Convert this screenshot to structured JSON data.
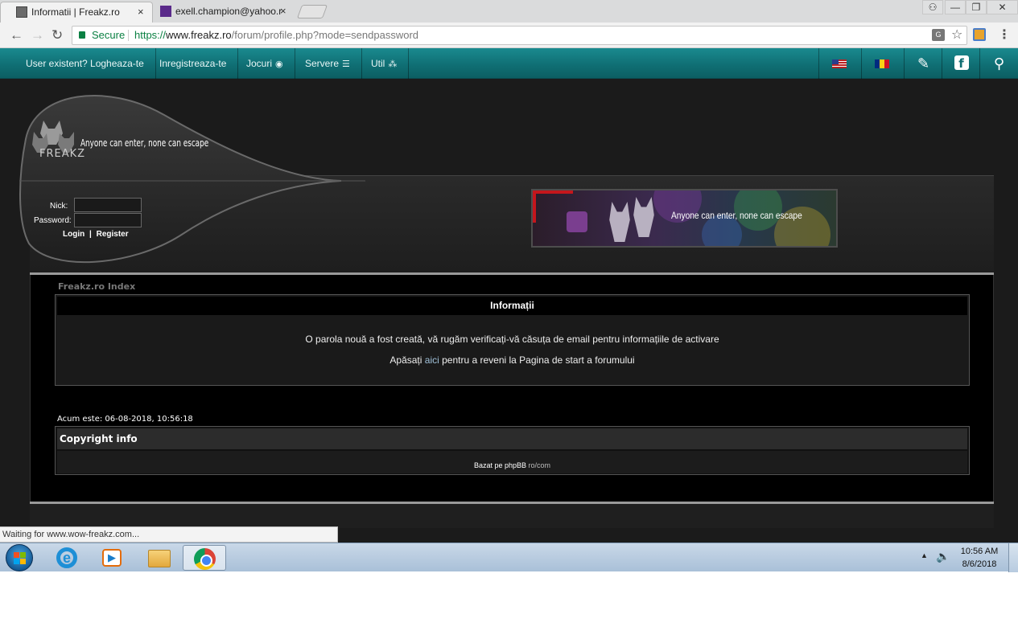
{
  "browser": {
    "tabs": [
      {
        "title": "Informatii | Freakz.ro"
      },
      {
        "title": "exell.champion@yahoo.r"
      }
    ],
    "close_glyph": "×",
    "address": {
      "secure_label": "Secure",
      "scheme": "https://",
      "host": "www.freakz.ro",
      "path": "/forum/profile.php?mode=sendpassword"
    },
    "window_controls": [
      "—",
      "❐",
      "✕"
    ]
  },
  "site": {
    "nav": {
      "login": "User existent? Logheaza-te",
      "register": "Inregistreaza-te",
      "games": "Jocuri",
      "servers": "Servere",
      "util": "Util"
    },
    "header": {
      "logo_text": "FREAKZ",
      "tagline": "Anyone can enter, none can escape",
      "banner_text": "Anyone can enter, none can escape"
    },
    "login_form": {
      "nick_label": "Nick:",
      "password_label": "Password:",
      "login_link": "Login",
      "separator": "|",
      "register_link": "Register"
    },
    "breadcrumb": "Freakz.ro Index",
    "info_box": {
      "title": "Informații",
      "message": "O parola nouă a fost creată, vă rugăm verificați-vă căsuța de email pentru informațiile de activare",
      "back_prefix": "Apăsați ",
      "back_link": "aici",
      "back_suffix": " pentru a reveni la Pagina de start a forumului"
    },
    "current_time": "Acum este: 06-08-2018, 10:56:18",
    "copyright": {
      "title": "Copyright info",
      "text": "Bazat pe phpBB",
      "suffix": " ro/com"
    }
  },
  "status_bar": "Waiting for www.wow-freakz.com...",
  "taskbar": {
    "time": "10:56 AM",
    "date": "8/6/2018"
  },
  "colors": {
    "nav_teal": "#0f6d72",
    "page_bg": "#1b1b1b",
    "secure_green": "#0b8043"
  }
}
